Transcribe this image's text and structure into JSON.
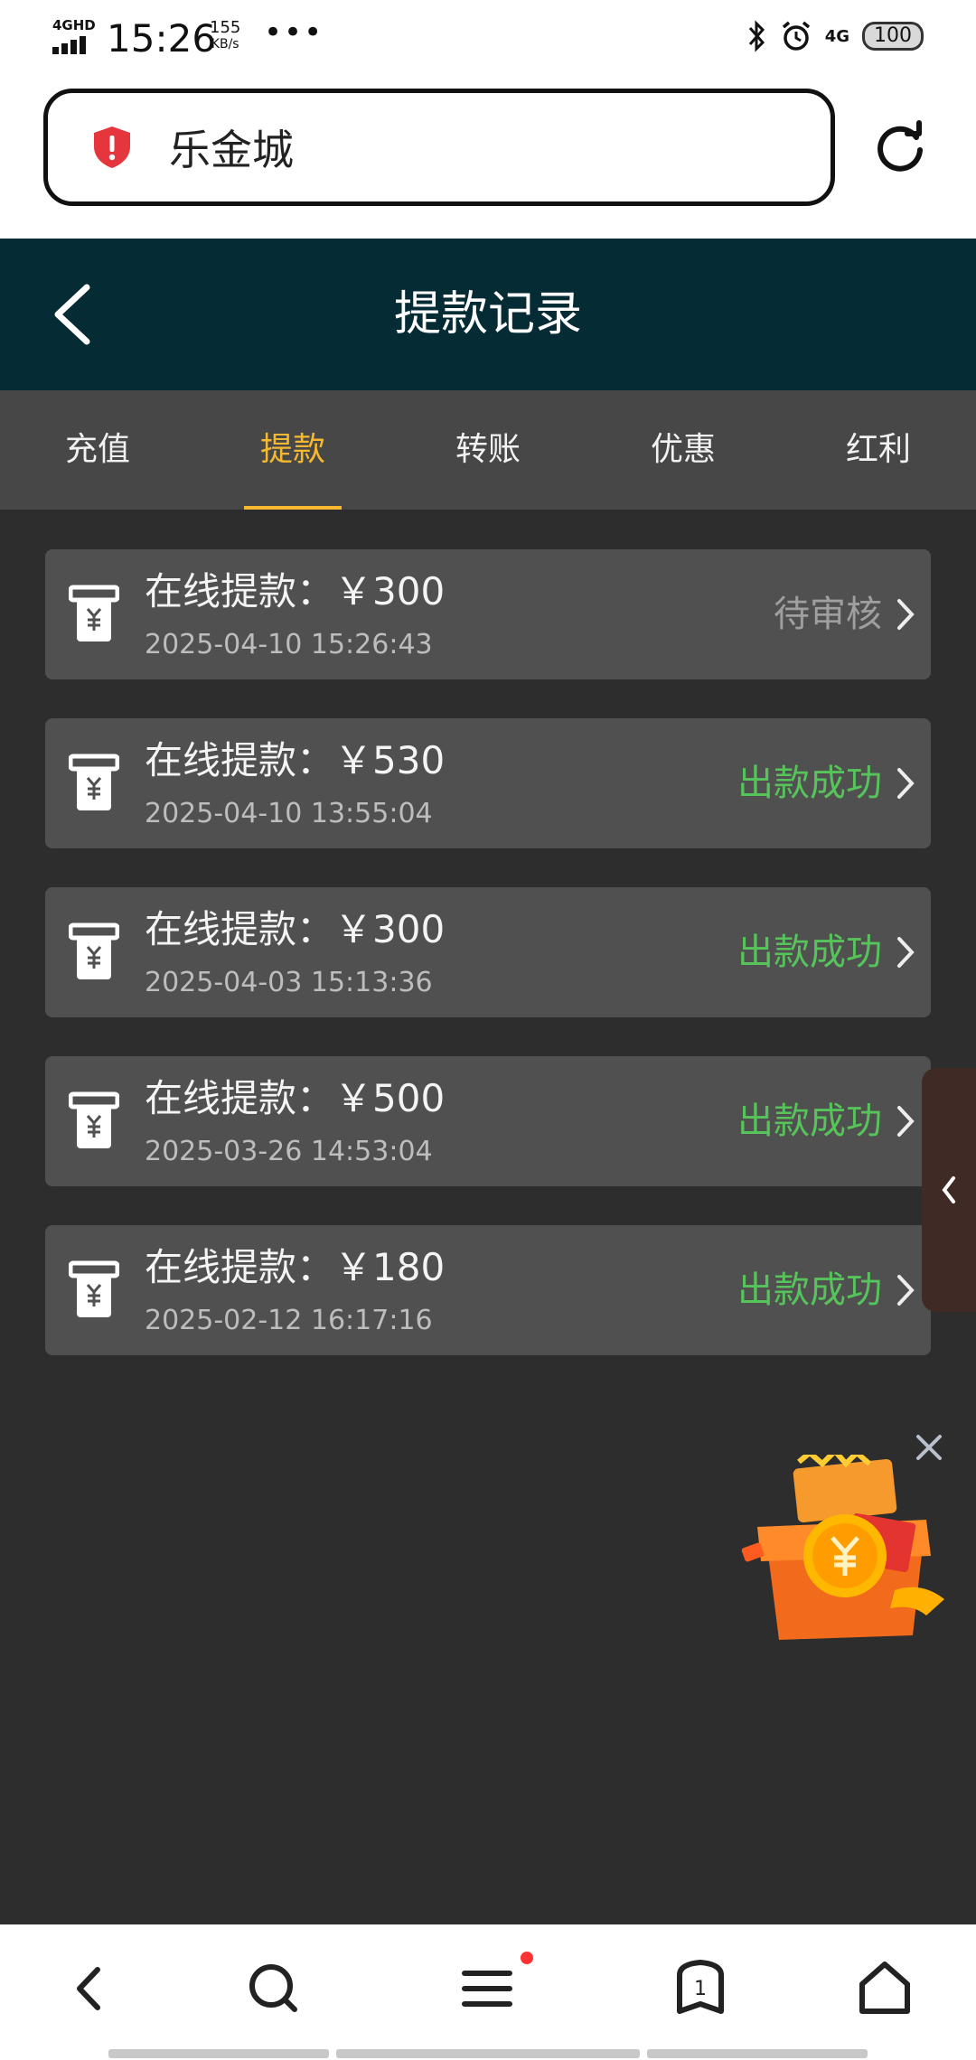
{
  "status_bar": {
    "network": "4GHD",
    "time": "15:26",
    "speed_value": "155",
    "speed_unit": "KB/s",
    "more": "•••",
    "right_network": "4G",
    "battery": "100"
  },
  "browser": {
    "url_text": "乐金城"
  },
  "header": {
    "title": "提款记录"
  },
  "tabs": [
    {
      "label": "充值",
      "active": false
    },
    {
      "label": "提款",
      "active": true
    },
    {
      "label": "转账",
      "active": false
    },
    {
      "label": "优惠",
      "active": false
    },
    {
      "label": "红利",
      "active": false
    }
  ],
  "records": [
    {
      "title": "在线提款：￥300",
      "date": "2025-04-10 15:26:43",
      "status": "待审核",
      "status_type": "pending"
    },
    {
      "title": "在线提款：￥530",
      "date": "2025-04-10 13:55:04",
      "status": "出款成功",
      "status_type": "success"
    },
    {
      "title": "在线提款：￥300",
      "date": "2025-04-03 15:13:36",
      "status": "出款成功",
      "status_type": "success"
    },
    {
      "title": "在线提款：￥500",
      "date": "2025-03-26 14:53:04",
      "status": "出款成功",
      "status_type": "success"
    },
    {
      "title": "在线提款：￥180",
      "date": "2025-02-12 16:17:16",
      "status": "出款成功",
      "status_type": "success"
    }
  ],
  "bottom_nav": {
    "tab_count": "1"
  },
  "colors": {
    "header_bg": "#052b34",
    "accent": "#f5b82e",
    "success": "#56c45a",
    "pending": "#9f9f9f"
  },
  "icons": {
    "shield": "shield-alert-icon",
    "reload": "reload-icon",
    "back": "back-arrow-icon",
    "record": "withdraw-receipt-icon",
    "chevron": "chevron-right-icon"
  }
}
